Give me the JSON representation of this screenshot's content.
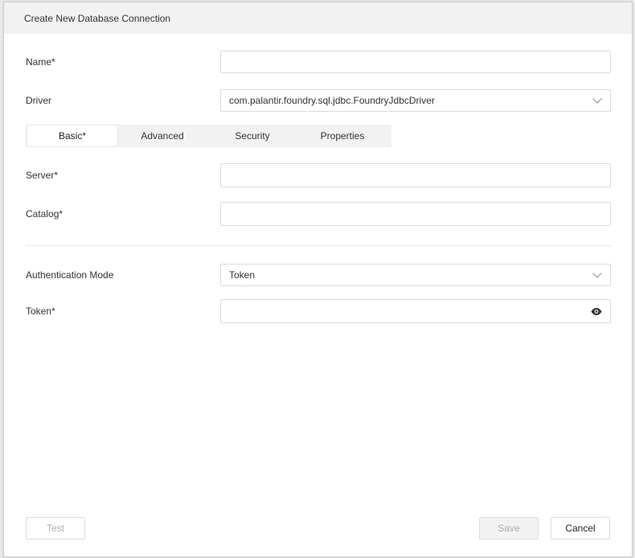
{
  "dialog": {
    "title": "Create New Database Connection"
  },
  "form": {
    "name": {
      "label": "Name*",
      "value": ""
    },
    "driver": {
      "label": "Driver",
      "value": "com.palantir.foundry.sql.jdbc.FoundryJdbcDriver"
    },
    "tabs": [
      {
        "label": "Basic*",
        "active": true
      },
      {
        "label": "Advanced",
        "active": false
      },
      {
        "label": "Security",
        "active": false
      },
      {
        "label": "Properties",
        "active": false
      }
    ],
    "server": {
      "label": "Server*",
      "value": ""
    },
    "catalog": {
      "label": "Catalog*",
      "value": ""
    },
    "auth_mode": {
      "label": "Authentication Mode",
      "value": "Token"
    },
    "token": {
      "label": "Token*",
      "value": "",
      "toggle_icon": "eye-icon"
    }
  },
  "footer": {
    "test_label": "Test",
    "save_label": "Save",
    "cancel_label": "Cancel"
  }
}
